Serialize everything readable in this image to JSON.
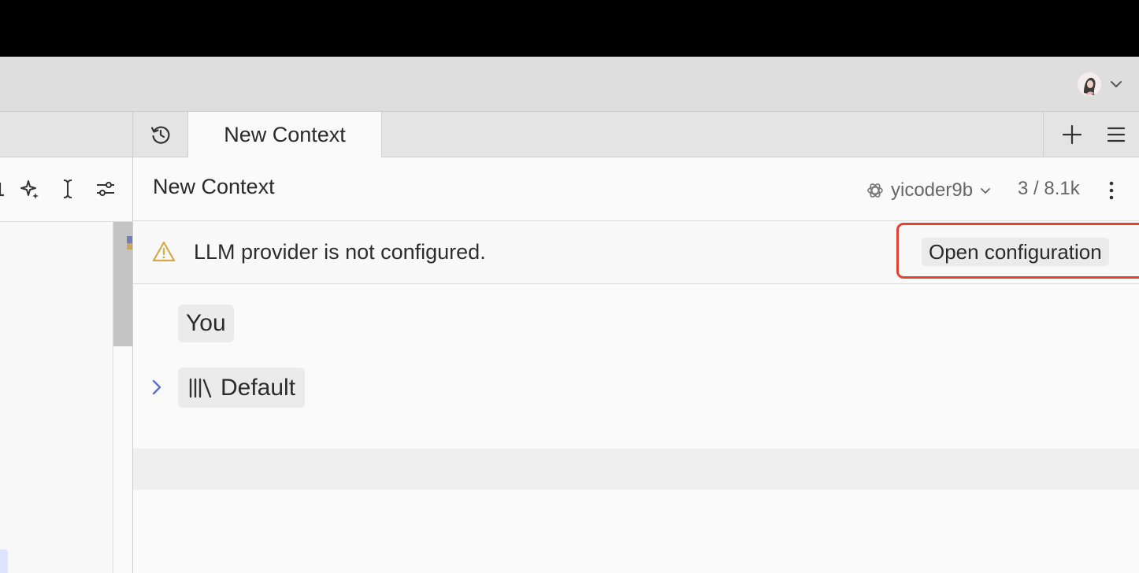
{
  "titlebar": {
    "avatar_icon": "user-avatar",
    "menu_chevron_icon": "chevron-down-icon"
  },
  "left_panel": {
    "toolbar_icons": [
      "text-cursor-partial-icon",
      "sparkles-icon",
      "text-cursor-icon",
      "sliders-icon"
    ]
  },
  "assistant": {
    "history_icon": "history-icon",
    "tab_label": "New Context",
    "new_tab_icon": "plus-icon",
    "menu_icon": "hamburger-menu-icon",
    "header": {
      "title": "New Context",
      "model_icon": "openai-logo-icon",
      "model_name": "yicoder9b",
      "token_count": "3 / 8.1k",
      "more_icon": "vertical-ellipsis-icon"
    },
    "banner": {
      "icon": "warning-icon",
      "message": "LLM provider is not configured.",
      "action_label": "Open configuration",
      "highlight_color": "#e2432e"
    },
    "messages": {
      "user_role_label": "You",
      "section_label": "Default",
      "section_icon": "library-icon",
      "expand_icon": "chevron-right-icon"
    }
  },
  "colors": {
    "accent_blue": "#5a6fd6",
    "warning_yellow": "#d6a94a"
  }
}
